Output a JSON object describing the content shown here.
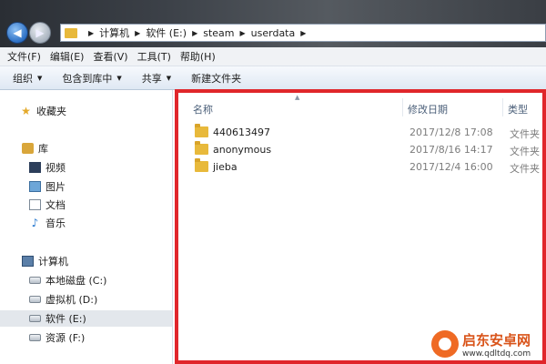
{
  "address_bar": {
    "crumbs": [
      "计算机",
      "软件 (E:)",
      "steam",
      "userdata"
    ]
  },
  "menu": [
    "文件(F)",
    "编辑(E)",
    "查看(V)",
    "工具(T)",
    "帮助(H)"
  ],
  "toolbar": {
    "organize": "组织",
    "include_in_library": "包含到库中",
    "share": "共享",
    "new_folder": "新建文件夹"
  },
  "nav": {
    "favorites": "收藏夹",
    "libraries": "库",
    "videos": "视频",
    "pictures": "图片",
    "documents": "文档",
    "music": "音乐",
    "computer": "计算机",
    "local_disk": "本地磁盘 (C:)",
    "virtual_disk": "虚拟机 (D:)",
    "software_drive": "软件 (E:)",
    "resources_drive": "资源 (F:)"
  },
  "columns": {
    "name": "名称",
    "date": "修改日期",
    "type": "类型"
  },
  "files": [
    {
      "name": "440613497",
      "date": "2017/12/8 17:08",
      "type": "文件夹"
    },
    {
      "name": "anonymous",
      "date": "2017/8/16 14:17",
      "type": "文件夹"
    },
    {
      "name": "jieba",
      "date": "2017/12/4 16:00",
      "type": "文件夹"
    }
  ],
  "watermark": {
    "name": "启东安卓网",
    "url": "www.qdltdq.com"
  },
  "colors": {
    "highlight_border": "#e0262b",
    "folder": "#e8b93b"
  }
}
